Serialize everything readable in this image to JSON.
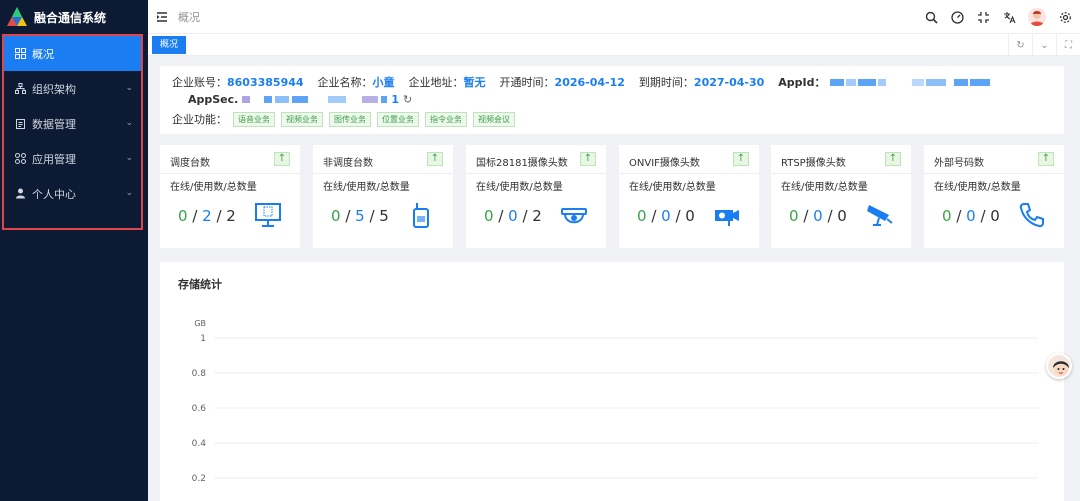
{
  "app": {
    "title": "融合通信系统"
  },
  "sidebar": {
    "items": [
      {
        "label": "概况",
        "icon": "grid-icon",
        "active": true
      },
      {
        "label": "组织架构",
        "icon": "org-icon",
        "active": false
      },
      {
        "label": "数据管理",
        "icon": "clipboard-icon",
        "active": false
      },
      {
        "label": "应用管理",
        "icon": "apps-icon",
        "active": false
      },
      {
        "label": "个人中心",
        "icon": "user-icon",
        "active": false
      }
    ]
  },
  "topbar": {
    "breadcrumb": "概况",
    "icons": [
      "search-icon",
      "dashboard-icon",
      "fullscreen-icon",
      "translate-icon",
      "avatar",
      "settings-icon"
    ]
  },
  "tabs": {
    "items": [
      {
        "label": "概况"
      }
    ]
  },
  "info": {
    "account_label": "企业账号：",
    "account_value": "8603385944",
    "name_label": "企业名称：",
    "name_value": "小童",
    "address_label": "企业地址：",
    "address_value": "暂无",
    "open_label": "开通时间：",
    "open_value": "2026-04-12",
    "expire_label": "到期时间：",
    "expire_value": "2027-04-30",
    "appid_label": "AppId：",
    "appsec_label": "AppSec.",
    "appsec_suffix": "1",
    "features_label": "企业功能：",
    "features": [
      "语音业务",
      "视频业务",
      "图传业务",
      "位置业务",
      "指令业务",
      "视频会议"
    ]
  },
  "cards": [
    {
      "title": "调度台数",
      "sub": "在线/使用数/总数量",
      "online": "0",
      "used": "2",
      "total": "2",
      "icon": "monitor-icon"
    },
    {
      "title": "非调度台数",
      "sub": "在线/使用数/总数量",
      "online": "0",
      "used": "5",
      "total": "5",
      "icon": "walkie-talkie-icon"
    },
    {
      "title": "国标28181摄像头数",
      "sub": "在线/使用数/总数量",
      "online": "0",
      "used": "0",
      "total": "2",
      "icon": "dome-camera-icon"
    },
    {
      "title": "ONVIF摄像头数",
      "sub": "在线/使用数/总数量",
      "online": "0",
      "used": "0",
      "total": "0",
      "icon": "bullet-camera-icon"
    },
    {
      "title": "RTSP摄像头数",
      "sub": "在线/使用数/总数量",
      "online": "0",
      "used": "0",
      "total": "0",
      "icon": "cctv-icon"
    },
    {
      "title": "外部号码数",
      "sub": "在线/使用数/总数量",
      "online": "0",
      "used": "0",
      "total": "0",
      "icon": "phone-icon"
    }
  ],
  "storage": {
    "title": "存储统计"
  },
  "chart_data": {
    "type": "line",
    "title": "",
    "ylabel": "GB",
    "ylim": [
      0,
      1
    ],
    "yticks": [
      "1",
      "0.8",
      "0.6",
      "0.4",
      "0.2"
    ],
    "series": [],
    "grid": true
  },
  "colors": {
    "primary": "#1a7ef2",
    "sidebar": "#0c1b33",
    "success": "#3aa248",
    "highlight_border": "#e0454c"
  }
}
